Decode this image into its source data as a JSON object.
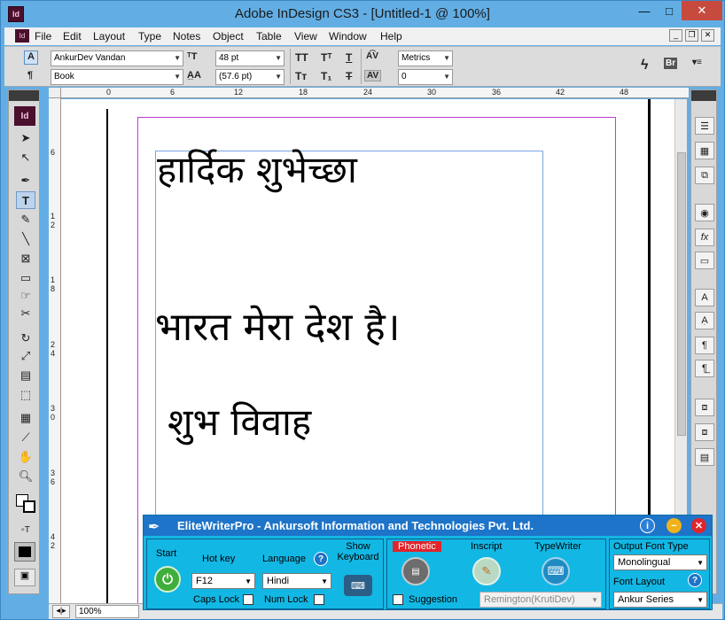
{
  "window": {
    "title": "Adobe InDesign CS3 - [Untitled-1 @ 100%]",
    "app_icon": "Id",
    "controls": {
      "minimize": "—",
      "maximize": "□",
      "close": "✕"
    }
  },
  "menu": [
    "File",
    "Edit",
    "Layout",
    "Type",
    "Notes",
    "Object",
    "Table",
    "View",
    "Window",
    "Help"
  ],
  "control_bar": {
    "font_family": "AnkurDev Vandan",
    "font_style": "Book",
    "font_size": "48 pt",
    "leading": "(57.6 pt)",
    "kerning": "Metrics",
    "tracking": "0"
  },
  "ruler_top": [
    "0",
    "6",
    "12",
    "18",
    "24",
    "30",
    "36",
    "42",
    "48"
  ],
  "ruler_left": [
    "6",
    "1 2",
    "1 8",
    "2 4",
    "3 0",
    "3 6",
    "4 2"
  ],
  "document": {
    "line1": "हार्दिक शुभेच्छा",
    "line2": "भारत मेरा देश है।",
    "line3": "शुभ विवाह"
  },
  "status": {
    "zoom": "100%"
  },
  "elitewriter": {
    "title": "EliteWriterPro - Ankursoft Information and Technologies Pvt. Ltd.",
    "start_label": "Start",
    "hotkey_label": "Hot key",
    "hotkey_value": "F12",
    "language_label": "Language",
    "language_value": "Hindi",
    "show_keyboard_label": "Show Keyboard",
    "caps_lock_label": "Caps Lock",
    "num_lock_label": "Num Lock",
    "phonetic_label": "Phonetic",
    "inscript_label": "Inscript",
    "typewriter_label": "TypeWriter",
    "suggestion_label": "Suggestion",
    "typewriter_layout_value": "Remington(KrutiDev)",
    "output_font_type_label": "Output  Font  Type",
    "output_font_type_value": "Monolingual",
    "font_layout_label": "Font Layout",
    "font_layout_value": "Ankur Series",
    "colors": {
      "title_bg": "#1e74c8",
      "body_bg": "#13b7e4",
      "phonetic_bg": "#e0242c",
      "start_green": "#3fae3a"
    }
  }
}
